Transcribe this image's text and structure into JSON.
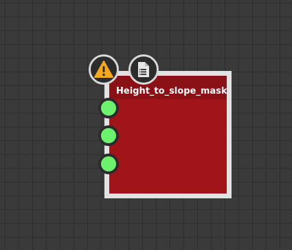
{
  "node": {
    "title": "Height_to_slope_mask",
    "ports": [
      {
        "state": "connected"
      },
      {
        "state": "connected"
      },
      {
        "state": "connected"
      }
    ]
  },
  "badges": [
    {
      "icon": "warning-icon"
    },
    {
      "icon": "document-icon"
    }
  ],
  "colors": {
    "canvas": "#3a3a3a",
    "node_frame": "#e2e2e2",
    "node_body": "#a11419",
    "port": "#6cf26c",
    "warning": "#f4a81d"
  }
}
